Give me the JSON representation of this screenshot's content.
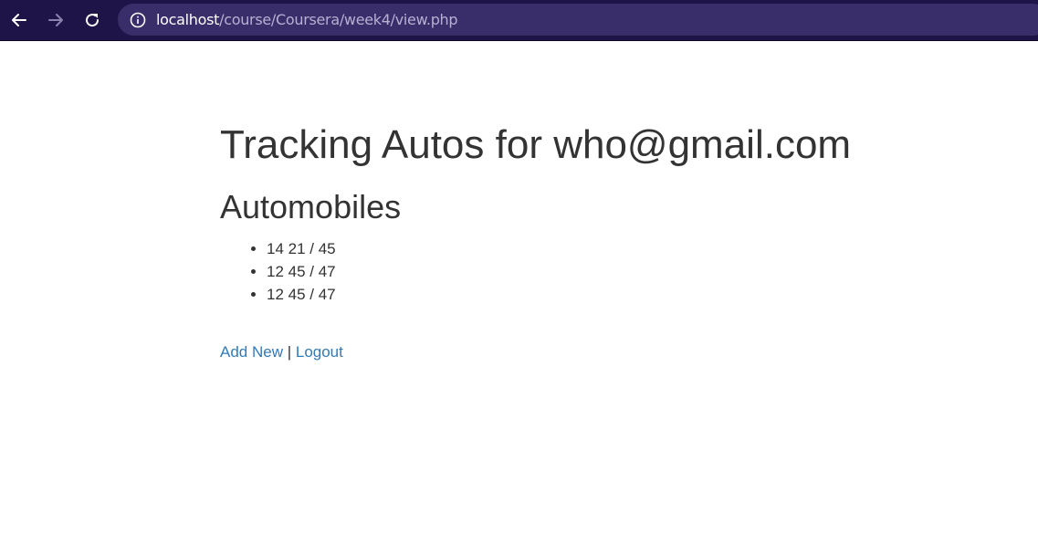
{
  "browser": {
    "url_host": "localhost",
    "url_path": "/course/Coursera/week4/view.php",
    "icons": {
      "back": "arrow-left-icon",
      "forward": "arrow-right-icon",
      "reload": "reload-icon",
      "site_info": "info-circle-icon"
    }
  },
  "page": {
    "title": "Tracking Autos for who@gmail.com",
    "section_heading": "Automobiles",
    "autos": [
      "14 21 / 45",
      "12 45 / 47",
      "12 45 / 47"
    ],
    "links": {
      "add_new": "Add New",
      "separator": " | ",
      "logout": "Logout"
    }
  },
  "colors": {
    "toolbar_bg": "#1f1448",
    "urlbar_bg": "#3a2e6a",
    "text": "#333333",
    "link": "#337ab7"
  }
}
